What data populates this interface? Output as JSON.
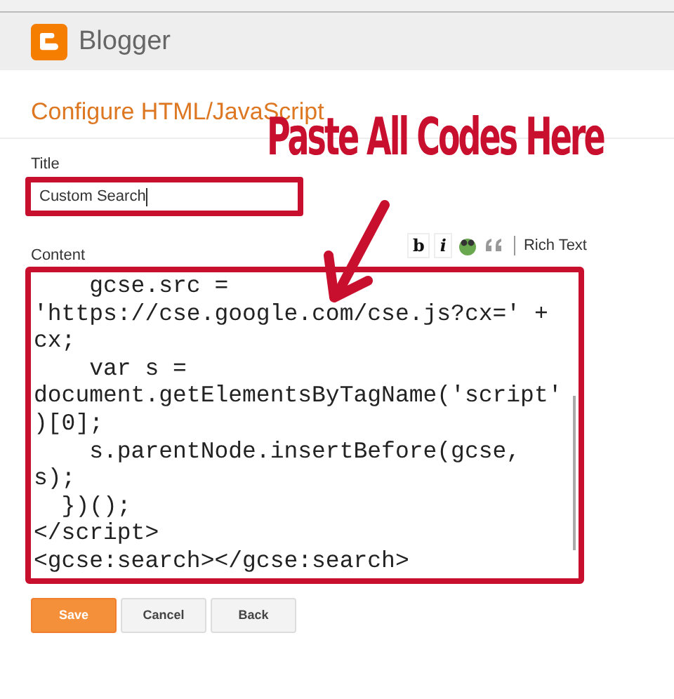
{
  "header": {
    "brand": "Blogger"
  },
  "page_title": "Configure HTML/JavaScript",
  "annotation": {
    "text": "Paste All Codes Here"
  },
  "title_field": {
    "label": "Title",
    "value": "Custom Search"
  },
  "content": {
    "label": "Content",
    "toolbar": [
      {
        "kind": "bold",
        "label": "b"
      },
      {
        "kind": "italic",
        "label": "i"
      },
      {
        "kind": "smiley"
      },
      {
        "kind": "quote"
      }
    ],
    "rich_text_link": "Rich Text",
    "code_lines": [
      "    gcse.src =",
      "'https://cse.google.com/cse.js?cx=' +",
      "cx;",
      "    var s =",
      "document.getElementsByTagName('script'",
      ")[0];",
      "    s.parentNode.insertBefore(gcse,",
      "s);",
      "  })();",
      "</script>",
      "<gcse:search></gcse:search>"
    ]
  },
  "buttons": [
    {
      "label": "Save",
      "kind": "primary"
    },
    {
      "label": "Cancel",
      "kind": "default"
    },
    {
      "label": "Back",
      "kind": "default"
    }
  ]
}
